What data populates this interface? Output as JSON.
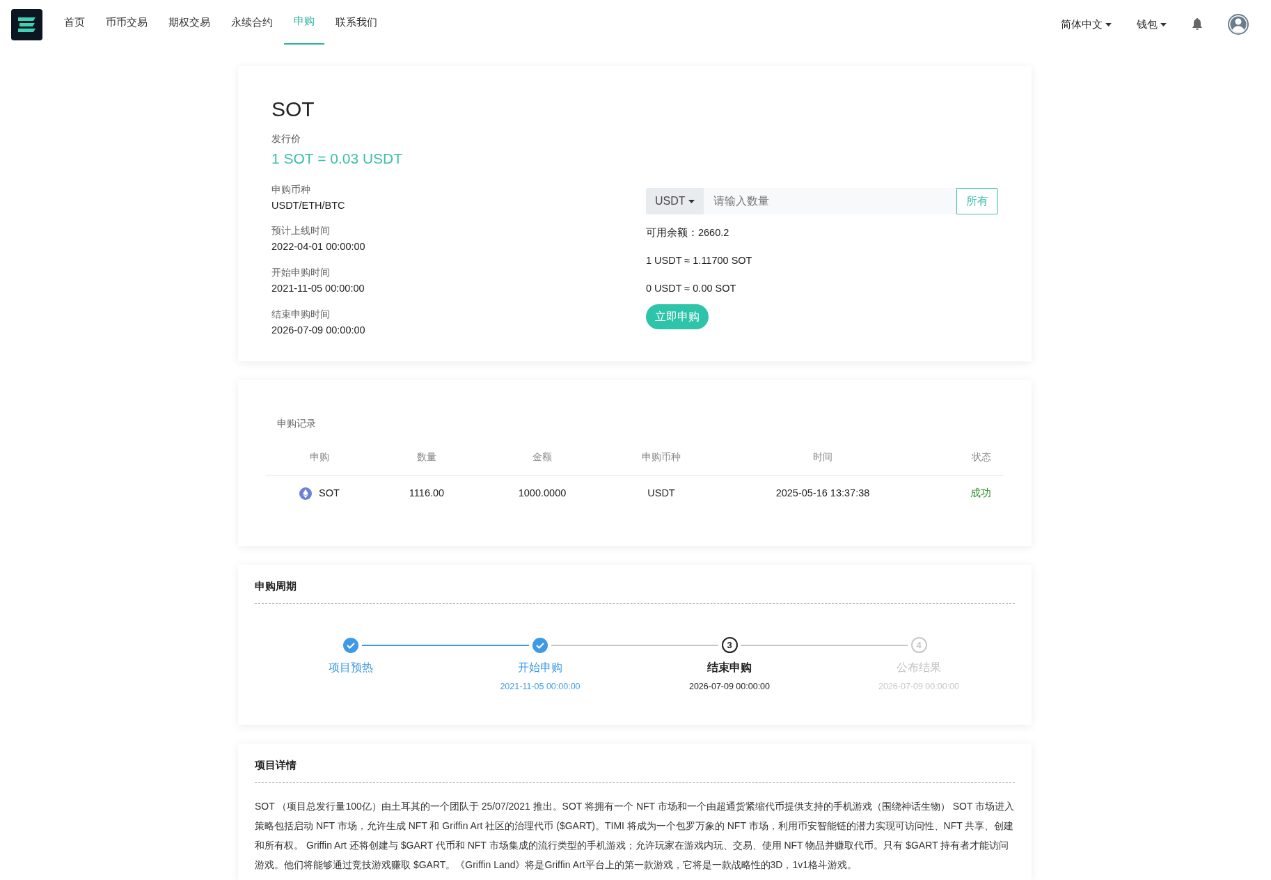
{
  "nav": {
    "items": [
      {
        "label": "首页",
        "selected": false
      },
      {
        "label": "币币交易",
        "selected": false
      },
      {
        "label": "期权交易",
        "selected": false
      },
      {
        "label": "永续合约",
        "selected": false
      },
      {
        "label": "申购",
        "selected": true
      },
      {
        "label": "联系我们",
        "selected": false
      }
    ],
    "language": "简体中文",
    "wallet": "钱包"
  },
  "offering": {
    "title": "SOT",
    "price_label": "发行价",
    "price": "1 SOT = 0.03 USDT",
    "fields": [
      {
        "label": "申购币种",
        "value": "USDT/ETH/BTC"
      },
      {
        "label": "预计上线时间",
        "value": "2022-04-01 00:00:00"
      },
      {
        "label": "开始申购时间",
        "value": "2021-11-05 00:00:00"
      },
      {
        "label": "结束申购时间",
        "value": "2026-07-09 00:00:00"
      }
    ],
    "currency": "USDT",
    "amount_placeholder": "请输入数量",
    "all_button": "所有",
    "balance": "可用余额：2660.2",
    "rate": "1 USDT ≈ 1.11700 SOT",
    "estimate": "0 USDT ≈ 0.00 SOT",
    "submit": "立即申购"
  },
  "records": {
    "title": "申购记录",
    "columns": [
      "申购",
      "数量",
      "金额",
      "申购币种",
      "时间",
      "状态"
    ],
    "rows": [
      {
        "cells": [
          "SOT",
          "1116.00",
          "1000.0000",
          "USDT",
          "2025-05-16 13:37:38",
          "成功"
        ]
      }
    ]
  },
  "cycle": {
    "title": "申购周期",
    "steps": [
      {
        "label": "项目预热",
        "kind": "done"
      },
      {
        "label": "开始申购",
        "date": "2021-11-05 00:00:00",
        "kind": "done"
      },
      {
        "label": "结束申购",
        "date": "2026-07-09 00:00:00",
        "kind": "current",
        "number": "3"
      },
      {
        "label": "公布结果",
        "date": "2026-07-09 00:00:00",
        "kind": "pending",
        "number": "4"
      }
    ]
  },
  "details": {
    "title": "项目详情",
    "text": "SOT （项目总发行量100亿）由土耳其的一个团队于 25/07/2021 推出。SOT 将拥有一个 NFT 市场和一个由超通货紧缩代币提供支持的手机游戏（围绕神话生物） SOT 市场进入策略包括启动 NFT 市场，允许生成 NFT 和 Griffin Art 社区的治理代币 ($GART)。TIMI 将成为一个包罗万象的 NFT 市场，利用币安智能链的潜力实现可访问性、NFT 共享、创建和所有权。 Griffin Art 还将创建与 $GART 代币和 NFT 市场集成的流行类型的手机游戏；允许玩家在游戏内玩、交易、使用 NFT 物品并赚取代币。只有 $GART 持有者才能访问游戏。他们将能够通过竞技游戏赚取 $GART。《Griffin Land》将是Griffin Art平台上的第一款游戏，它将是一款战略性的3D，1v1格斗游戏。"
  }
}
